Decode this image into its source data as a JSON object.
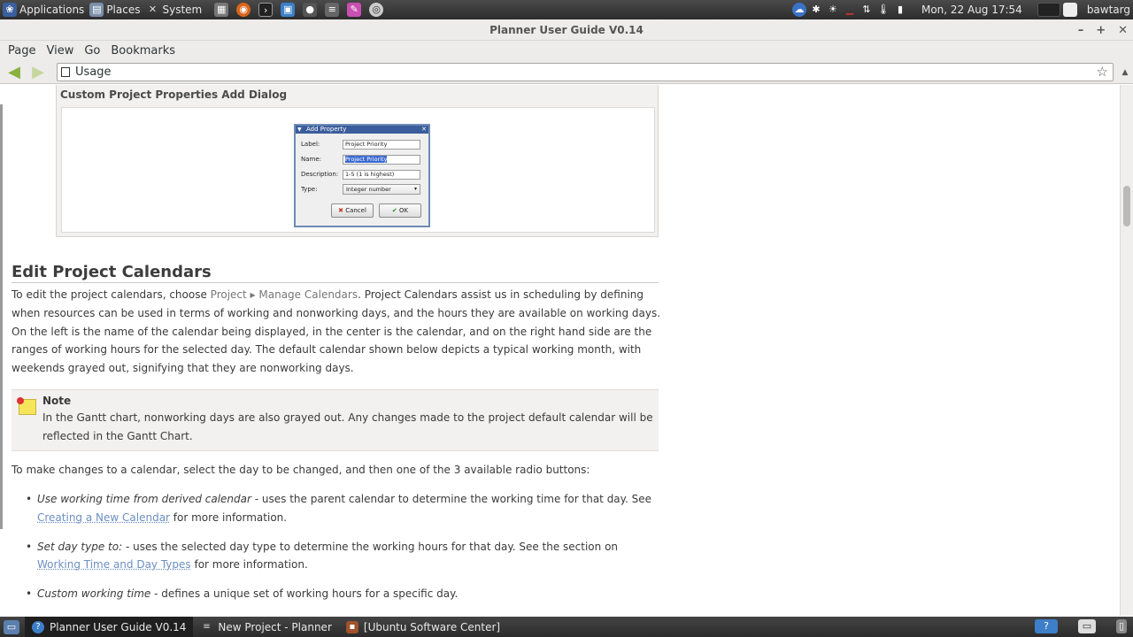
{
  "top_panel": {
    "applications": "Applications",
    "places": "Places",
    "system": "System",
    "clock": "Mon, 22 Aug  17:54",
    "user": "bawtarg"
  },
  "window": {
    "title": "Planner User Guide V0.14"
  },
  "menubar": {
    "items": [
      "Page",
      "View",
      "Go",
      "Bookmarks"
    ]
  },
  "toolbar": {
    "location": "Usage"
  },
  "figure": {
    "title": "Custom Project Properties Add Dialog",
    "dialog": {
      "title": "Add Property",
      "label_label": "Label:",
      "label_value": "Project Priority",
      "name_label": "Name:",
      "name_value": "Project Priority",
      "description_label": "Description:",
      "description_value": "1-5 (1 is highest)",
      "type_label": "Type:",
      "type_value": "Integer number",
      "cancel": "Cancel",
      "ok": "OK"
    }
  },
  "section": {
    "heading": "Edit Project Calendars",
    "intro_before": "To edit the project calendars, choose ",
    "menu_project": "Project",
    "menu_sep": " ▸ ",
    "menu_manage": "Manage Calendars",
    "intro_after": ". Project Calendars assist us in scheduling by defining when resources can be used in terms of working and nonworking days, and the hours they are available on working days. On the left is the name of the calendar being displayed, in the center is the calendar, and on the right hand side are the ranges of working hours for the selected day. The default calendar shown below depicts a typical working month, with weekends grayed out, signifying that they are nonworking days."
  },
  "note": {
    "title": "Note",
    "text": "In the Gantt chart, nonworking days are also grayed out. Any changes made to the project default calendar will be reflected in the Gantt Chart."
  },
  "changes_intro": "To make changes to a calendar, select the day to be changed, and then one of the 3 available radio buttons:",
  "bullets": [
    {
      "term": "Use working time from derived calendar",
      "text": " - uses the parent calendar to determine the working time for that day. See ",
      "link": "Creating a New Calendar",
      "tail": " for more information."
    },
    {
      "term": "Set day type to:",
      "text": " - uses the selected day type to determine the working hours for that day. See the section on ",
      "link": "Working Time and Day Types",
      "tail": " for more information."
    },
    {
      "term": "Custom working time",
      "text": " - defines a unique set of working hours for a specific day.",
      "link": "",
      "tail": ""
    }
  ],
  "taskbar": {
    "tasks": [
      "Planner User Guide V0.14",
      "New Project - Planner",
      "[Ubuntu Software Center]"
    ]
  }
}
